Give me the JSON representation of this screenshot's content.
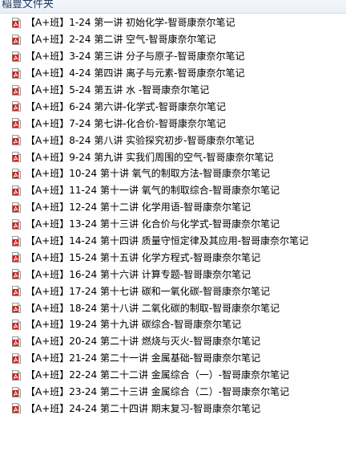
{
  "header": {
    "title": "稲豊文件夹"
  },
  "colors": {
    "pdf_icon_red": "#c8231c",
    "header_text": "#1e395b"
  },
  "files": [
    {
      "name": "【A+班】1-24 第一讲 初始化学-智哥康奈尔笔记",
      "icon": "pdf-file-icon"
    },
    {
      "name": "【A+班】2-24 第二讲 空气-智哥康奈尔笔记",
      "icon": "pdf-file-icon"
    },
    {
      "name": "【A+班】3-24 第三讲 分子与原子-智哥康奈尔笔记",
      "icon": "pdf-file-icon"
    },
    {
      "name": "【A+班】4-24 第四讲 离子与元素-智哥康奈尔笔记",
      "icon": "pdf-file-icon"
    },
    {
      "name": "【A+班】5-24 第五讲 水 -智哥康奈尔笔记",
      "icon": "pdf-file-icon"
    },
    {
      "name": "【A+班】6-24 第六讲-化学式-智哥康奈尔笔记",
      "icon": "pdf-file-icon"
    },
    {
      "name": "【A+班】7-24 第七讲-化合价-智哥康奈尔笔记",
      "icon": "pdf-file-icon"
    },
    {
      "name": "【A+班】8-24 第八讲 实验探究初步-智哥康奈尔笔记",
      "icon": "pdf-file-icon"
    },
    {
      "name": "【A+班】9-24 第九讲 实我们周围的空气-智哥康奈尔笔记",
      "icon": "pdf-file-icon"
    },
    {
      "name": "【A+班】10-24 第十讲 氧气的制取方法-智哥康奈尔笔记",
      "icon": "pdf-file-icon"
    },
    {
      "name": "【A+班】11-24 第十一讲 氧气的制取综合-智哥康奈尔笔记",
      "icon": "pdf-file-icon"
    },
    {
      "name": "【A+班】12-24 第十二讲 化学用语-智哥康奈尔笔记",
      "icon": "pdf-file-icon"
    },
    {
      "name": "【A+班】13-24 第十三讲 化合价与化学式-智哥康奈尔笔记",
      "icon": "pdf-file-icon"
    },
    {
      "name": "【A+班】14-24 第十四讲 质量守恒定律及其应用-智哥康奈尔笔记",
      "icon": "pdf-file-icon"
    },
    {
      "name": "【A+班】15-24 第十五讲 化学方程式-智哥康奈尔笔记",
      "icon": "pdf-file-icon"
    },
    {
      "name": "【A+班】16-24 第十六讲 计算专题-智哥康奈尔笔记",
      "icon": "pdf-file-icon"
    },
    {
      "name": "【A+班】17-24 第十七讲 碳和一氧化碳-智哥康奈尔笔记",
      "icon": "pdf-file-icon"
    },
    {
      "name": "【A+班】18-24 第十八讲 二氧化碳的制取-智哥康奈尔笔记",
      "icon": "pdf-file-icon"
    },
    {
      "name": "【A+班】19-24 第十九讲 碳综合-智哥康奈尔笔记",
      "icon": "pdf-file-icon"
    },
    {
      "name": "【A+班】20-24 第二十讲 燃烧与灭火-智哥康奈尔笔记",
      "icon": "pdf-file-icon"
    },
    {
      "name": "【A+班】21-24 第二十一讲 金属基础-智哥康奈尔笔记",
      "icon": "pdf-file-icon"
    },
    {
      "name": "【A+班】22-24 第二十二讲 金属综合（一）-智哥康奈尔笔记",
      "icon": "pdf-file-icon"
    },
    {
      "name": "【A+班】23-24 第二十三讲 金属综合（二）-智哥康奈尔笔记",
      "icon": "pdf-file-icon"
    },
    {
      "name": "【A+班】24-24 第二十四讲 期末复习-智哥康奈尔笔记",
      "icon": "pdf-file-icon"
    }
  ]
}
